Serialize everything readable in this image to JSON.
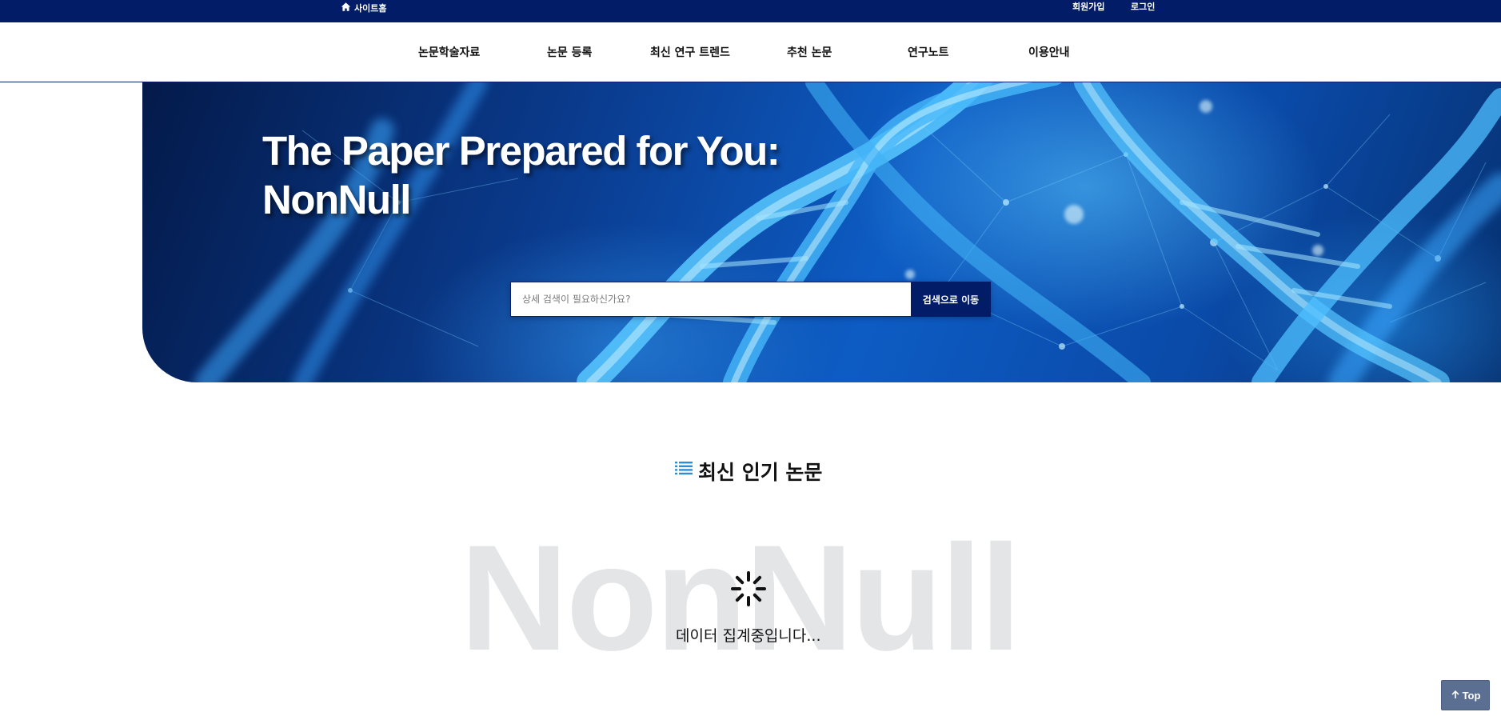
{
  "topbar": {
    "home_label": "사이트홈",
    "home_icon": "home-icon",
    "signup_label": "회원가입",
    "login_label": "로그인",
    "background_color": "#031c68"
  },
  "nav": {
    "items": [
      {
        "label": "논문학술자료"
      },
      {
        "label": "논문 등록"
      },
      {
        "label": "최신 연구 트렌드"
      },
      {
        "label": "추천 논문"
      },
      {
        "label": "연구노트"
      },
      {
        "label": "이용안내"
      }
    ]
  },
  "hero": {
    "title_line1": "The Paper Prepared for You:",
    "title_line2": "NonNull",
    "search": {
      "placeholder": "상세 검색이 필요하신가요?",
      "value": "",
      "button_label": "검색으로 이동"
    }
  },
  "popular": {
    "title": "최신 인기 논문",
    "icon": "list-icon",
    "watermark": "NonNull",
    "loading_text": "데이터 집계중입니다..."
  },
  "to_top": {
    "label": "Top",
    "icon": "arrow-up-icon"
  },
  "colors": {
    "primary": "#031c68",
    "accent_icon": "#2b8fd6",
    "watermark": "#e3e5e6",
    "top_button": "#5b6f92"
  }
}
